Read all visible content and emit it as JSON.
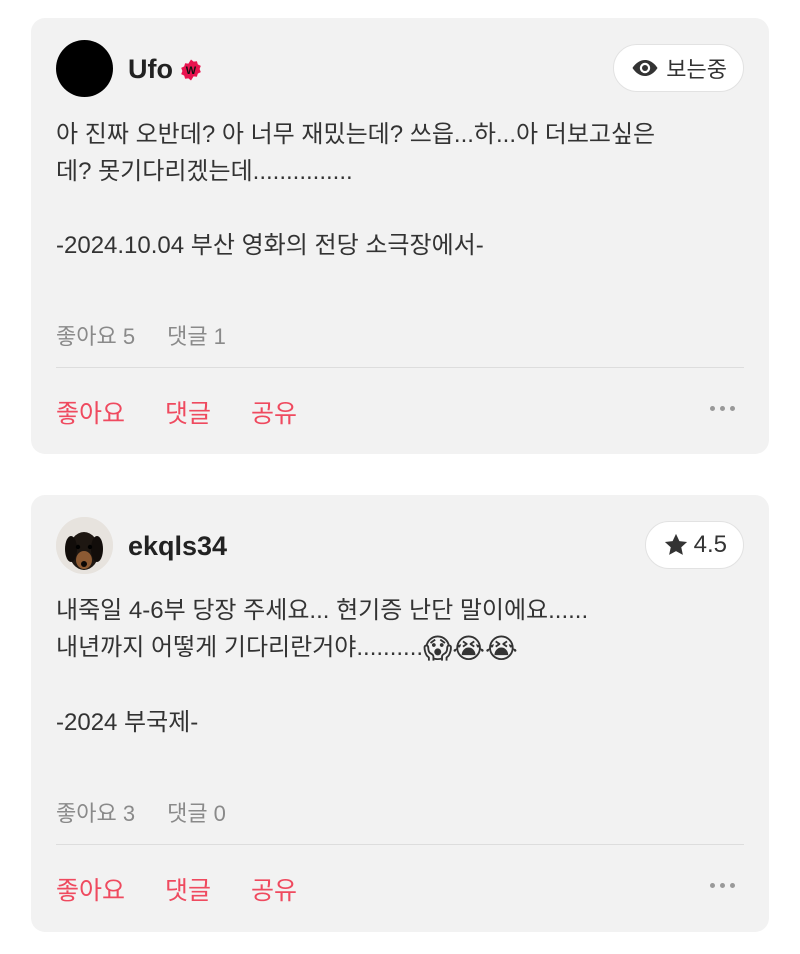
{
  "reviews": [
    {
      "user": "Ufo",
      "badge_icon": "watcha-badge-icon",
      "status_label": "보는중",
      "status_icon": "eye-icon",
      "text_lines": [
        "아 진짜 오반데? 아 너무 재밌는데? 쓰읍...하...아 더보고싶은",
        "데? 못기다리겠는데..............."
      ],
      "footer_line": "-2024.10.04 부산 영화의 전당 소극장에서-",
      "likes": "좋아요 5",
      "comments": "댓글 1",
      "actions": {
        "like": "좋아요",
        "comment": "댓글",
        "share": "공유"
      }
    },
    {
      "user": "ekqls34",
      "rating": "4.5",
      "rating_icon": "star-icon",
      "text_lines": [
        "내죽일 4-6부 당장 주세요... 현기증 난단 말이에요......",
        "내년까지 어떻게 기다리란거야.........."
      ],
      "emojis": [
        "😱",
        "😭",
        "😭"
      ],
      "footer_line": "-2024 부국제-",
      "likes": "좋아요 3",
      "comments": "댓글 0",
      "actions": {
        "like": "좋아요",
        "comment": "댓글",
        "share": "공유"
      }
    }
  ],
  "colors": {
    "accent": "#ef4a5f",
    "card_bg": "#f2f2f2",
    "muted": "#8a8a8a"
  }
}
